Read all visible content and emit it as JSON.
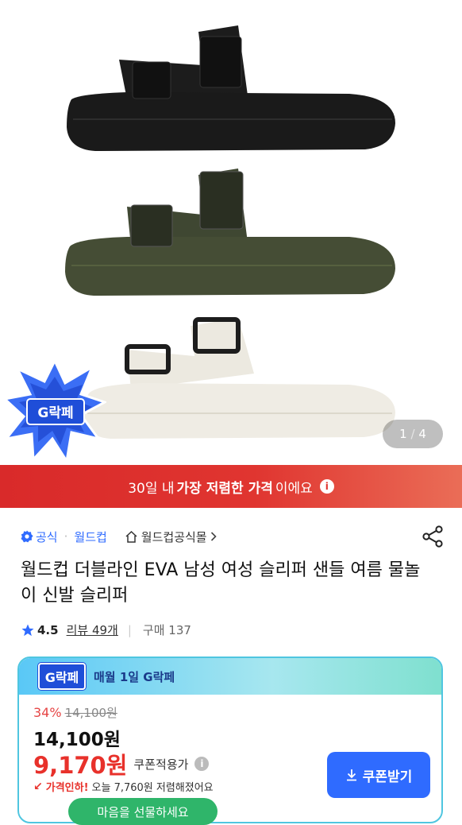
{
  "gallery": {
    "current": "1",
    "total": "4",
    "separator": "/"
  },
  "sticker": {
    "label": "G락페"
  },
  "promo": {
    "prefix": "30일 내 ",
    "highlight": "가장 저렴한 가격",
    "suffix": "이에요"
  },
  "seller": {
    "official_label": "공식",
    "separator": "·",
    "brand": "월드컵",
    "shop_name": "월드컵공식몰"
  },
  "product": {
    "title": "월드컵 더블라인 EVA 남성 여성 슬리퍼 샌들 여름 물놀이 신발 슬리퍼"
  },
  "rating": {
    "score": "4.5",
    "reviews": "리뷰 49개",
    "separator": "|",
    "sold": "구매 137"
  },
  "deal": {
    "badge": "G락페",
    "header": "매월 1일 G락페",
    "discount_percent": "34%",
    "original_price": "14,100원",
    "sale_price": "14,100원",
    "coupon_price": "9,170원",
    "coupon_note": "쿠폰적용가",
    "price_drop_label": "가격인하!",
    "price_drop_text": "오늘 7,760원 저렴해졌어요",
    "coupon_button": "쿠폰받기"
  },
  "gift_button": "마음을 선물하세요",
  "colors": {
    "promo_red": "#e0332e",
    "accent_blue": "#2f6bff",
    "price_red": "#e8312b",
    "shoe_black": "#1c1c1c",
    "shoe_olive": "#454d35",
    "shoe_cream": "#ece9e0"
  }
}
